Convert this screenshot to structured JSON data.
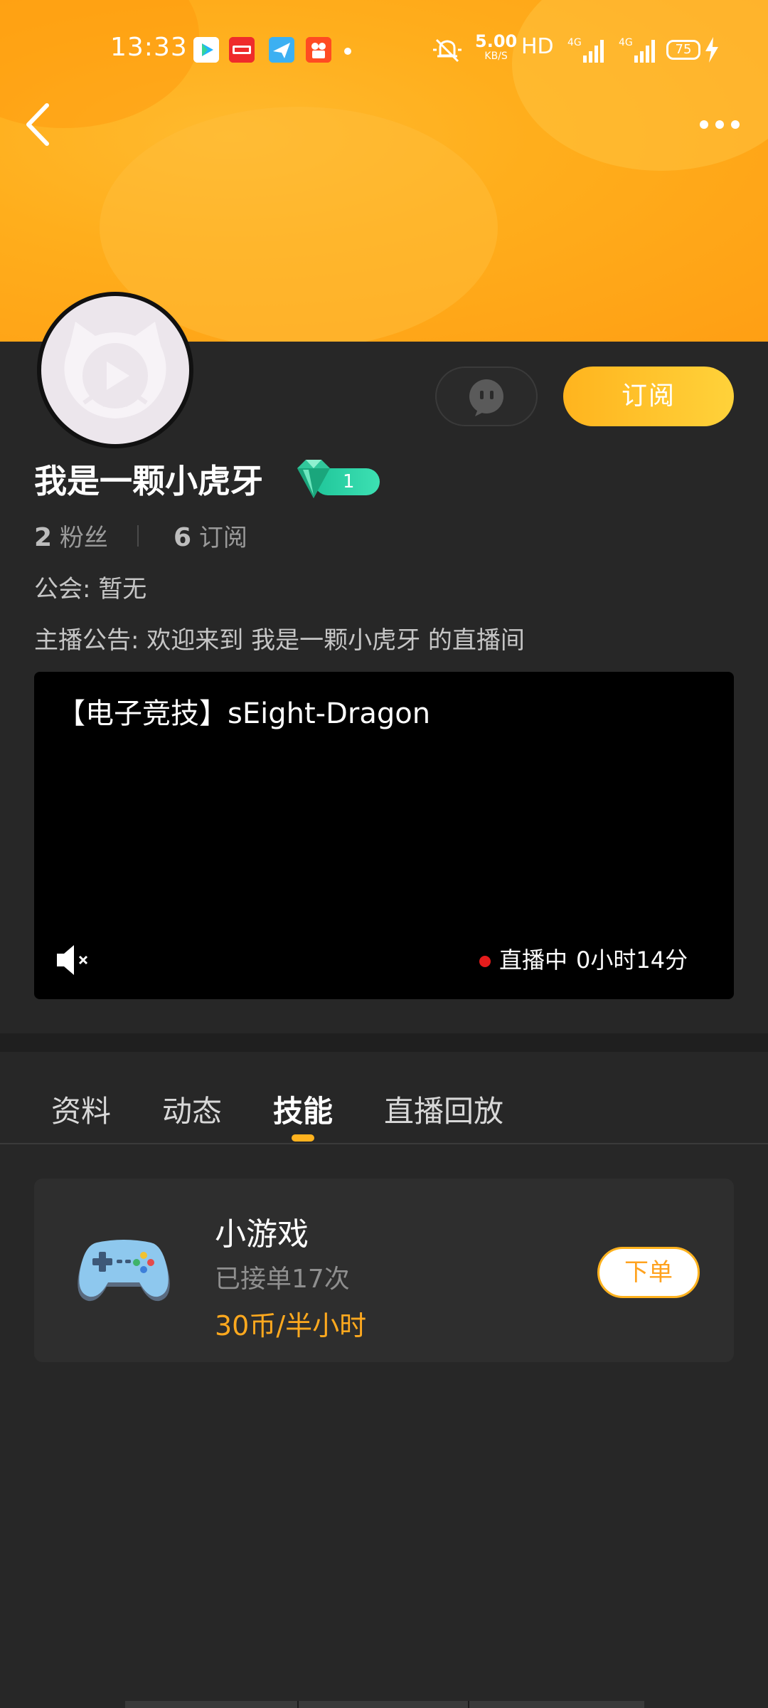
{
  "status_bar": {
    "time": "13:33",
    "net_speed_value": "5.00",
    "net_speed_unit": "KB/S",
    "hd_label": "HD",
    "signal_label_1": "4G",
    "signal_label_2": "4G",
    "battery": "75"
  },
  "profile": {
    "name": "我是一颗小虎牙",
    "level": "1",
    "fans_count": "2",
    "fans_label": "粉丝",
    "subs_count": "6",
    "subs_label": "订阅",
    "guild": "公会: 暂无",
    "notice": "主播公告: 欢迎来到 我是一颗小虎牙 的直播间",
    "subscribe_label": "订阅"
  },
  "video": {
    "title": "【电子竞技】sEight-Dragon",
    "live_label": "直播中",
    "live_duration": "0小时14分"
  },
  "tabs": [
    {
      "label": "资料"
    },
    {
      "label": "动态"
    },
    {
      "label": "技能"
    },
    {
      "label": "直播回放"
    }
  ],
  "active_tab": "技能",
  "skill": {
    "name": "小游戏",
    "orders": "已接单17次",
    "price": "30币/半小时",
    "order_button": "下单"
  },
  "colors": {
    "accent": "#ffb21e",
    "banner": "#ffae1c",
    "background": "#272727",
    "live_dot": "#e51c1c",
    "level_badge": "#20c69a"
  },
  "icons": {
    "back": "chevron-left-icon",
    "more": "more-dots-icon",
    "message": "chat-bubble-icon",
    "mute": "speaker-mute-icon",
    "skill": "gamepad-icon",
    "level": "gem-icon"
  }
}
